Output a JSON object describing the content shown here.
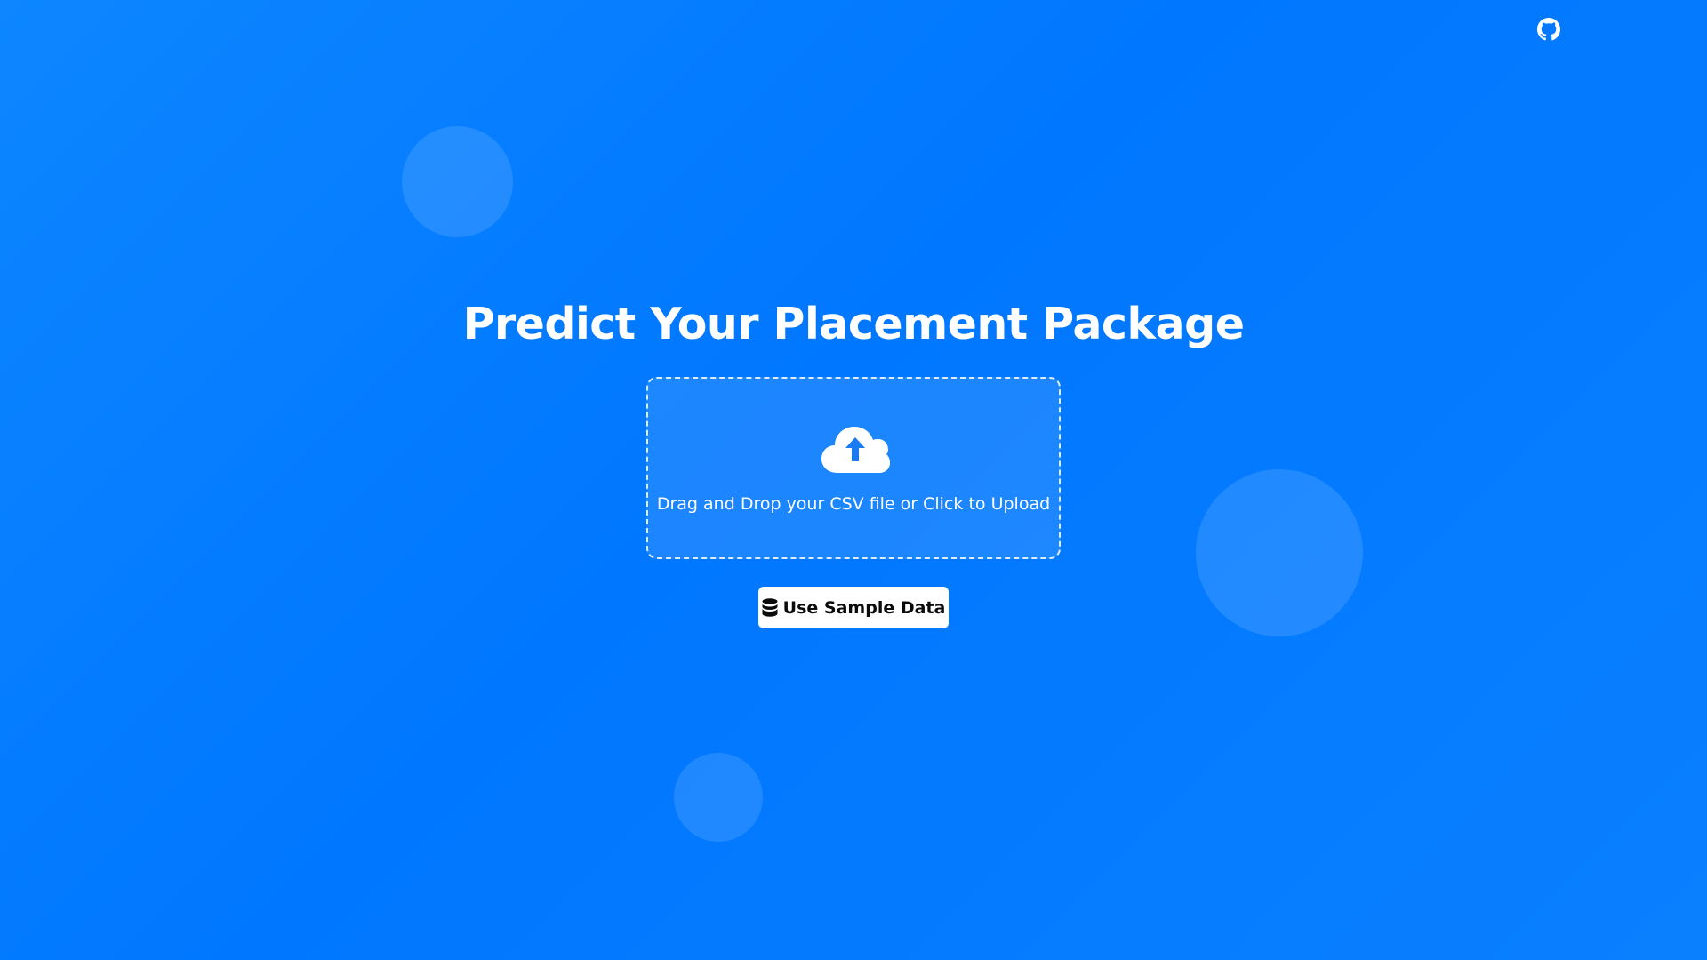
{
  "header": {
    "github_icon": "github-icon"
  },
  "main": {
    "title": "Predict Your Placement Package",
    "upload": {
      "icon": "cloud-upload-icon",
      "text": "Drag and Drop your CSV file or Click to Upload"
    },
    "sample_button": {
      "icon": "database-icon",
      "label": "Use Sample Data"
    }
  },
  "colors": {
    "background": "#0077ff",
    "text": "#ffffff",
    "button_background": "#ffffff",
    "button_text": "#0b0b0b",
    "accent": "#1a7cf0"
  }
}
